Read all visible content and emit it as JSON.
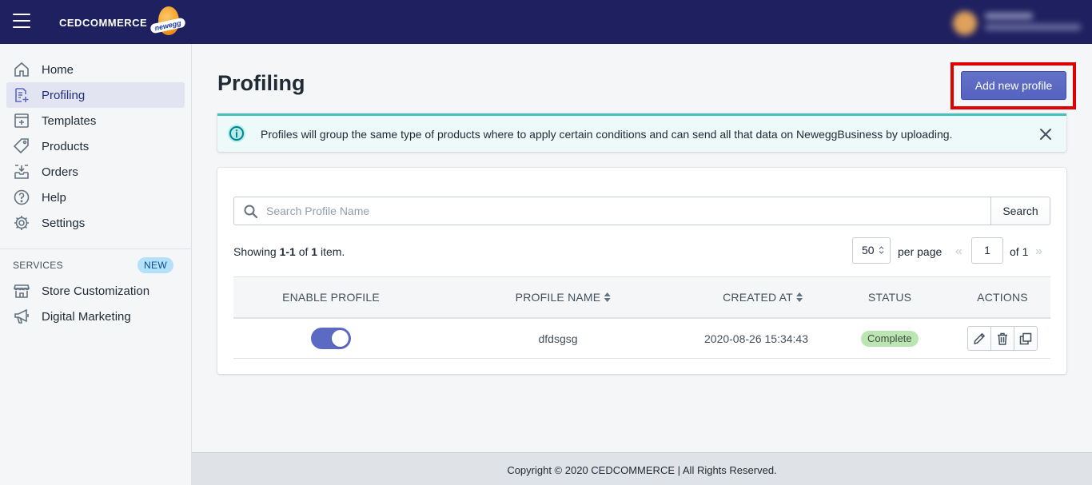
{
  "header": {
    "logo_text": "CEDCOMMERCE",
    "logo_badge_text": "newegg",
    "brand_color": "#1f2060"
  },
  "sidebar": {
    "items": [
      {
        "label": "Home",
        "icon": "home-icon"
      },
      {
        "label": "Profiling",
        "icon": "profiling-icon",
        "active": true
      },
      {
        "label": "Templates",
        "icon": "templates-icon"
      },
      {
        "label": "Products",
        "icon": "tag-icon"
      },
      {
        "label": "Orders",
        "icon": "inbox-download-icon"
      },
      {
        "label": "Help",
        "icon": "question-circle-icon"
      },
      {
        "label": "Settings",
        "icon": "gear-icon"
      }
    ],
    "services_title": "SERVICES",
    "services_badge": "NEW",
    "services": [
      {
        "label": "Store Customization",
        "icon": "storefront-icon"
      },
      {
        "label": "Digital Marketing",
        "icon": "megaphone-icon"
      }
    ]
  },
  "page": {
    "title": "Profiling",
    "add_button_label": "Add new profile",
    "accent_color": "#5c6ac4",
    "highlight_color": "#e00000"
  },
  "banner": {
    "message": "Profiles will group the same type of products where to apply certain conditions and can send all that data on NeweggBusiness by uploading.",
    "icon": "info-circle-icon",
    "close_icon": "close-icon"
  },
  "search": {
    "placeholder": "Search Profile Name",
    "value": "",
    "button_label": "Search"
  },
  "pagination": {
    "showing_prefix": "Showing ",
    "showing_range": "1-1",
    "showing_mid": " of ",
    "showing_total": "1",
    "showing_suffix": " item.",
    "per_page_value": "50",
    "per_page_label": "per page",
    "prev_symbol": "«",
    "current_page": "1",
    "of_pages": "of 1",
    "next_symbol": "»"
  },
  "table": {
    "columns": [
      "ENABLE PROFILE",
      "PROFILE NAME",
      "CREATED AT",
      "STATUS",
      "ACTIONS"
    ],
    "rows": [
      {
        "enabled": true,
        "profile_name": "dfdsgsg",
        "created_at": "2020-08-26 15:34:43",
        "status": "Complete",
        "actions": [
          "edit-icon",
          "trash-icon",
          "duplicate-icon"
        ]
      }
    ]
  },
  "footer": {
    "text": "Copyright © 2020 CEDCOMMERCE | All Rights Reserved."
  }
}
